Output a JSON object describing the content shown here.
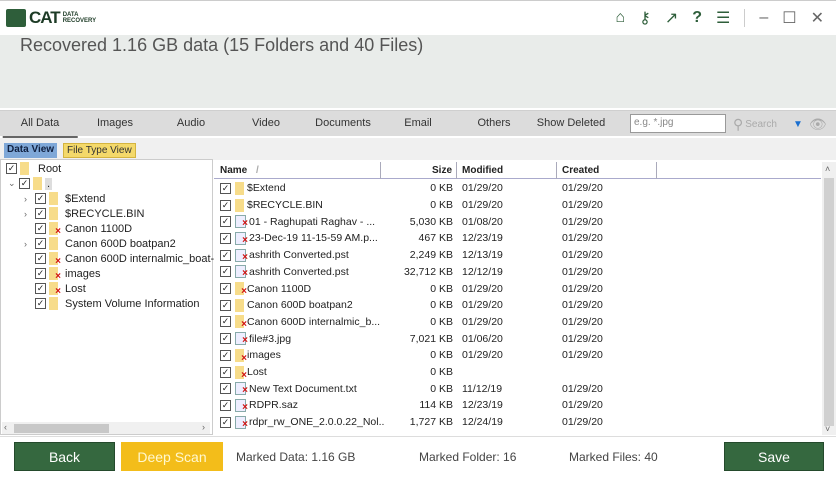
{
  "app": {
    "logo_text": "CAT",
    "logo_sub": "DATA RECOVERY"
  },
  "window_icons": [
    "home-icon",
    "key-icon",
    "arrow-up-right-icon",
    "help-icon",
    "menu-icon",
    "minimize-icon",
    "maximize-icon",
    "close-icon"
  ],
  "header": {
    "title": "Recovered 1.16 GB data (15 Folders and 40 Files)"
  },
  "tabs": [
    {
      "label": "All Data",
      "active": true
    },
    {
      "label": "Images"
    },
    {
      "label": "Audio"
    },
    {
      "label": "Video"
    },
    {
      "label": "Documents"
    },
    {
      "label": "Email"
    },
    {
      "label": "Others"
    },
    {
      "label": "Show Deleted"
    }
  ],
  "search": {
    "placeholder": "e.g. *.jpg",
    "button": "Search"
  },
  "view_tabs": {
    "data_view": "Data View",
    "file_type_view": "File Type View"
  },
  "tree": {
    "root": "Root",
    "drive": ".",
    "items": [
      {
        "label": "$Extend",
        "expand": true,
        "deleted": false
      },
      {
        "label": "$RECYCLE.BIN",
        "expand": true,
        "deleted": false
      },
      {
        "label": "Canon 1100D",
        "expand": false,
        "deleted": true
      },
      {
        "label": "Canon 600D boatpan2",
        "expand": true,
        "deleted": false
      },
      {
        "label": "Canon 600D internalmic_boat-",
        "expand": false,
        "deleted": true
      },
      {
        "label": "images",
        "expand": false,
        "deleted": true
      },
      {
        "label": "Lost",
        "expand": false,
        "deleted": true
      },
      {
        "label": "System Volume Information",
        "expand": false,
        "deleted": false
      }
    ]
  },
  "columns": {
    "name": "Name",
    "size": "Size",
    "modified": "Modified",
    "created": "Created"
  },
  "files": [
    {
      "name": "$Extend",
      "size": "0 KB",
      "modified": "01/29/20",
      "created": "01/29/20",
      "type": "folder"
    },
    {
      "name": "$RECYCLE.BIN",
      "size": "0 KB",
      "modified": "01/29/20",
      "created": "01/29/20",
      "type": "folder"
    },
    {
      "name": "01 - Raghupati Raghav - ...",
      "size": "5,030 KB",
      "modified": "01/08/20",
      "created": "01/29/20",
      "type": "file-deleted"
    },
    {
      "name": "23-Dec-19 11-15-59 AM.p...",
      "size": "467 KB",
      "modified": "12/23/19",
      "created": "01/29/20",
      "type": "file-deleted"
    },
    {
      "name": "ashrith Converted.pst",
      "size": "2,249 KB",
      "modified": "12/13/19",
      "created": "01/29/20",
      "type": "file-deleted"
    },
    {
      "name": "ashrith Converted.pst",
      "size": "32,712 KB",
      "modified": "12/12/19",
      "created": "01/29/20",
      "type": "file-deleted"
    },
    {
      "name": "Canon 1100D",
      "size": "0 KB",
      "modified": "01/29/20",
      "created": "01/29/20",
      "type": "folder-deleted"
    },
    {
      "name": "Canon 600D boatpan2",
      "size": "0 KB",
      "modified": "01/29/20",
      "created": "01/29/20",
      "type": "folder"
    },
    {
      "name": "Canon 600D internalmic_b...",
      "size": "0 KB",
      "modified": "01/29/20",
      "created": "01/29/20",
      "type": "folder-deleted"
    },
    {
      "name": "file#3.jpg",
      "size": "7,021 KB",
      "modified": "01/06/20",
      "created": "01/29/20",
      "type": "file-deleted"
    },
    {
      "name": "images",
      "size": "0 KB",
      "modified": "01/29/20",
      "created": "01/29/20",
      "type": "folder-deleted"
    },
    {
      "name": "Lost",
      "size": "0 KB",
      "modified": "",
      "created": "",
      "type": "folder-deleted"
    },
    {
      "name": "New Text Document.txt",
      "size": "0 KB",
      "modified": "11/12/19",
      "created": "01/29/20",
      "type": "file-deleted"
    },
    {
      "name": "RDPR.saz",
      "size": "114 KB",
      "modified": "12/23/19",
      "created": "01/29/20",
      "type": "file-deleted"
    },
    {
      "name": "rdpr_rw_ONE_2.0.0.22_Nol...",
      "size": "1,727 KB",
      "modified": "12/24/19",
      "created": "01/29/20",
      "type": "file-deleted"
    }
  ],
  "footer": {
    "back": "Back",
    "deep_scan": "Deep Scan",
    "marked_data": "Marked Data:  1.16 GB",
    "marked_folder": "Marked Folder:  16",
    "marked_files": "Marked Files:  40",
    "save": "Save"
  }
}
